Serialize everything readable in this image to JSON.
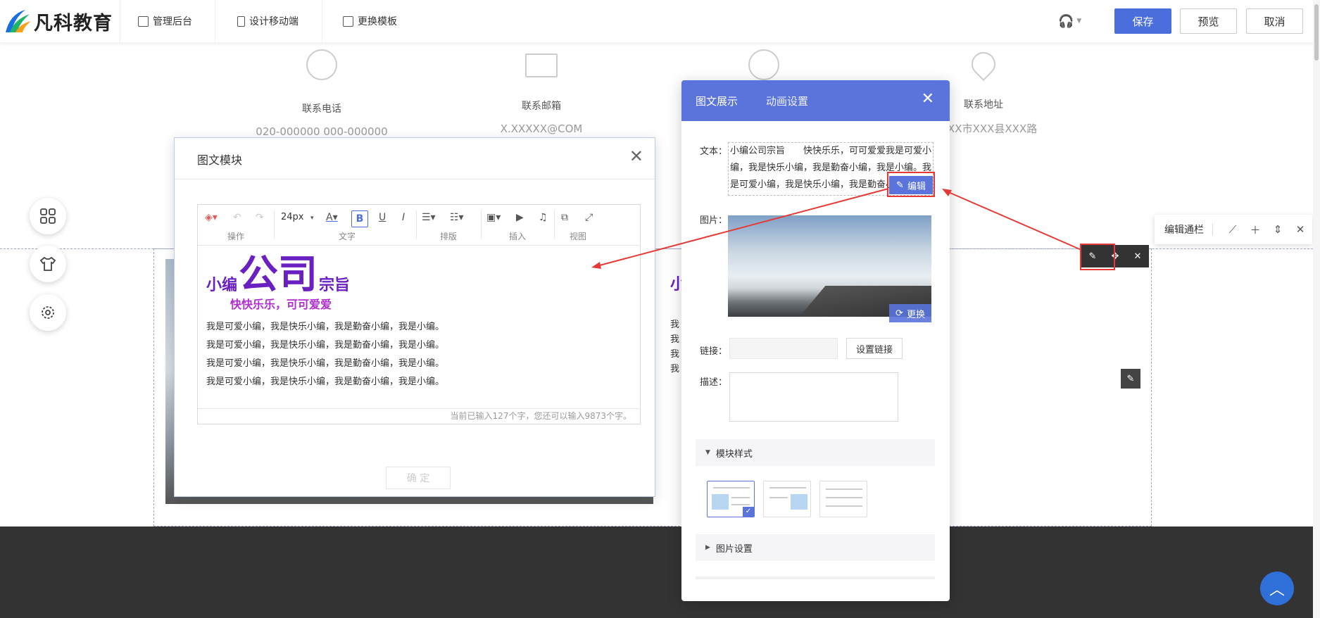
{
  "topbar": {
    "logo_text": "凡科教育",
    "nav": [
      {
        "label": "管理后台"
      },
      {
        "label": "设计移动端"
      },
      {
        "label": "更换模板"
      }
    ],
    "save_label": "保存",
    "preview_label": "预览",
    "cancel_label": "取消"
  },
  "contacts": [
    {
      "label": "联系电话",
      "value": "020-000000 000-000000"
    },
    {
      "label": "联系邮箱",
      "value": "X.XXXXX@COM"
    },
    {
      "label": "",
      "value": ""
    },
    {
      "label": "联系地址",
      "value": "省XXX市XXX县XXX路"
    }
  ],
  "dialog": {
    "title": "图文模块",
    "toolbar": {
      "font_size": "24px",
      "groups": [
        "操作",
        "文字",
        "排版",
        "插入",
        "视图"
      ]
    },
    "content": {
      "heading_small_1": "小编",
      "heading_big": "公司",
      "heading_small_2": "宗旨",
      "subheading": "快快乐乐，可可爱爱",
      "lines": [
        "我是可爱小编，我是快乐小编，我是勤奋小编，我是小编。",
        "我是可爱小编，我是快乐小编，我是勤奋小编，我是小编。",
        "我是可爱小编，我是快乐小编，我是勤奋小编，我是小编。",
        "我是可爱小编，我是快乐小编，我是勤奋小编，我是小编。"
      ]
    },
    "char_count": "当前已输入127个字，您还可以输入9873个字。",
    "ok_label": "确 定"
  },
  "panel": {
    "tabs": [
      {
        "label": "图文展示"
      },
      {
        "label": "动画设置"
      }
    ],
    "text_label": "文本：",
    "text_preview": "小编公司宗旨　　快快乐乐，可可爱爱我是可爱小编，我是快乐小编，我是勤奋小编，我是小编。我是可爱小编，我是快乐小编，我是勤奋小编，我是小编。",
    "edit_label": "编辑",
    "image_label": "图片：",
    "replace_label": "更换",
    "link_label": "链接：",
    "set_link_label": "设置链接",
    "desc_label": "描述：",
    "module_style_label": "模块样式",
    "image_settings_label": "图片设置"
  },
  "edit_bar": {
    "label": "编辑通栏"
  },
  "colors": {
    "primary": "#4a6fdc",
    "panel_header": "#5a74dc",
    "heading_purple": "#6a1fc0",
    "sub_purple": "#b02ed0",
    "highlight_red": "#e53935",
    "footer": "#333333"
  },
  "icons": {
    "float": [
      "grid-icon",
      "shirt-icon",
      "gear-icon"
    ],
    "contacts": [
      "phone-icon",
      "mail-icon",
      "qq-icon",
      "location-icon"
    ]
  }
}
